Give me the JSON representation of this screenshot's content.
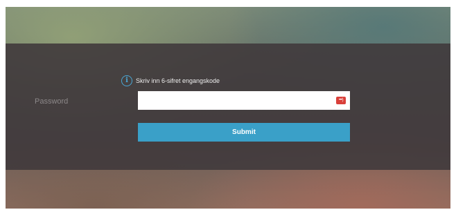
{
  "form": {
    "hint_icon": "info-icon",
    "hint_text": "Skriv inn 6-sifret engangskode",
    "password_label": "Password",
    "password_value": "",
    "password_placeholder": "",
    "password_field_icon": "keyboard-icon",
    "submit_label": "Submit"
  },
  "colors": {
    "accent": "#3aa0c8",
    "info_icon": "#4aa7d6",
    "field_icon": "#d9403a",
    "panel": "#403a3c"
  }
}
